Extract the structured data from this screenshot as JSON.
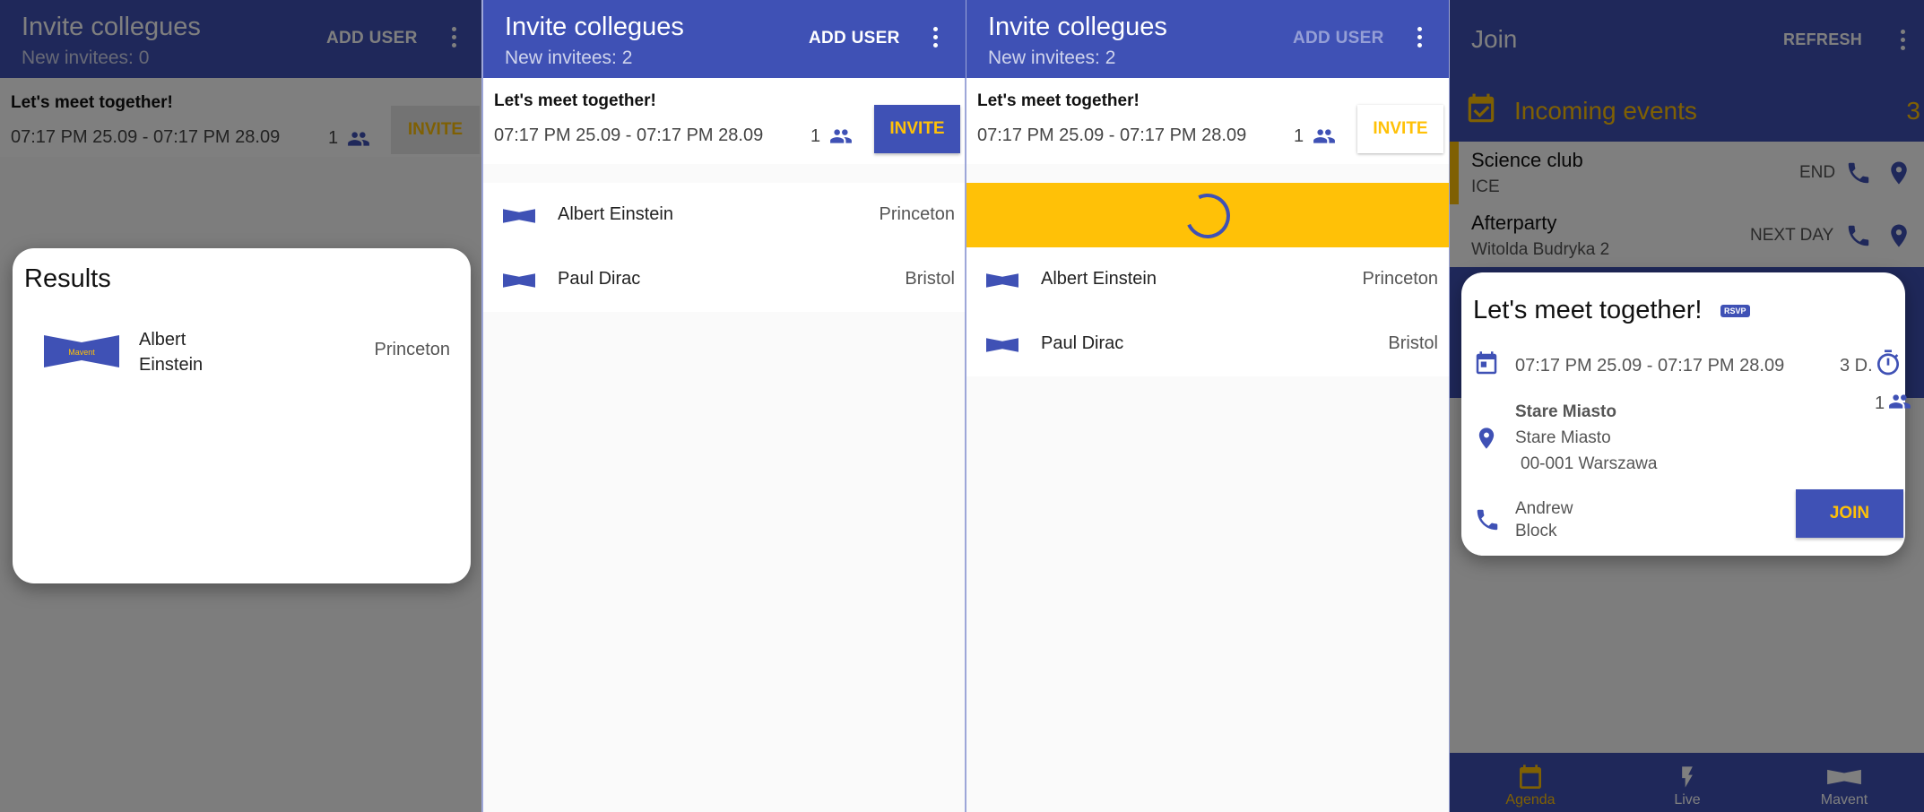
{
  "invite": {
    "title": "Invite collegues",
    "invitees_0": "New invitees: 0",
    "invitees_2": "New invitees: 2",
    "add_user": "ADD USER",
    "event_name": "Let's meet together!",
    "dates": "07:17 PM 25.09 - 07:17 PM 28.09",
    "count": "1",
    "invite_label": "INVITE"
  },
  "results": {
    "title": "Results",
    "first_name": "Albert",
    "last_name": "Einstein",
    "city": "Princeton",
    "logo_text": "Mavent"
  },
  "users": [
    {
      "name": "Albert Einstein",
      "city": "Princeton"
    },
    {
      "name": "Paul Dirac",
      "city": "Bristol"
    }
  ],
  "join": {
    "title": "Join",
    "refresh": "REFRESH",
    "incoming_label": "Incoming events",
    "incoming_count": "3",
    "events": [
      {
        "name": "Science club",
        "place": "ICE",
        "status": "END"
      },
      {
        "name": "Afterparty",
        "place": "Witolda Budryka 2",
        "status": "NEXT DAY"
      }
    ],
    "card": {
      "title": "Let's meet together!",
      "rsvp": "RSVP",
      "dates": "07:17 PM 25.09 - 07:17 PM 28.09",
      "duration": "3 D.",
      "people": "1",
      "location_name": "Stare Miasto",
      "address1": "Stare Miasto",
      "address2": "00-001 Warszawa",
      "contact_first": "Andrew",
      "contact_last": "Block",
      "join_label": "JOIN"
    },
    "nav": [
      "Agenda",
      "Live",
      "Mavent"
    ]
  },
  "colors": {
    "primary": "#3f51b5",
    "accent": "#ffc107"
  }
}
